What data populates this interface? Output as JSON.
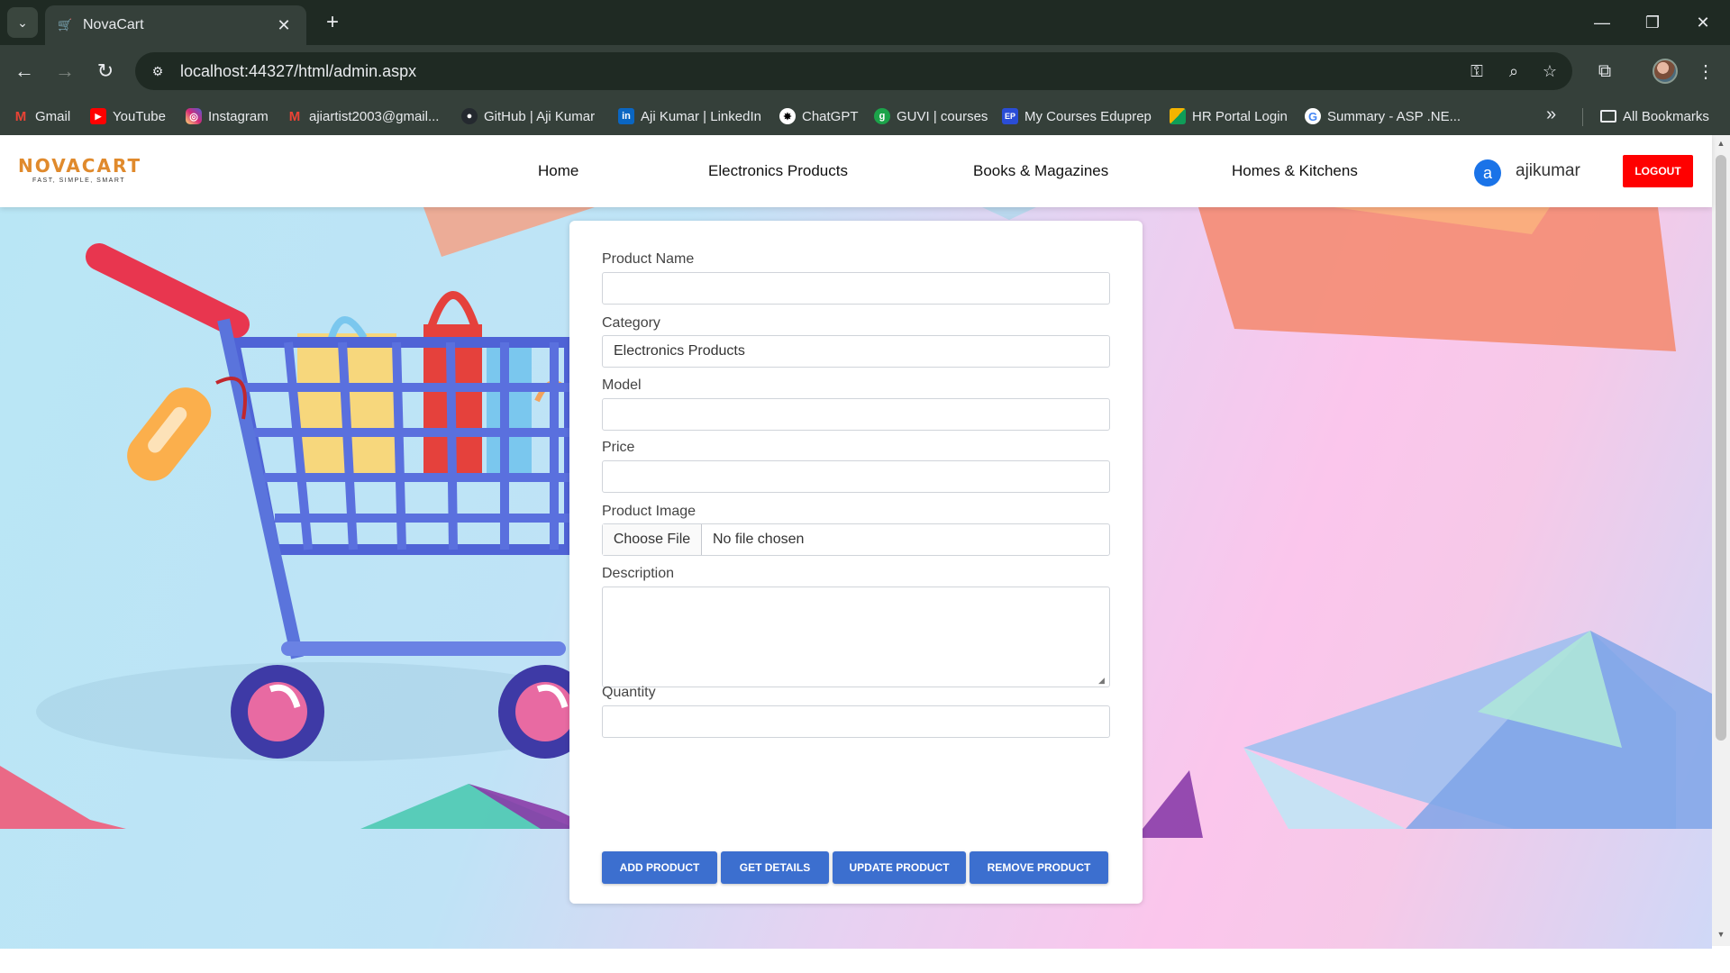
{
  "browser": {
    "tab_title": "NovaCart",
    "url": "localhost:44327/html/admin.aspx",
    "bookmarks": [
      {
        "label": "Gmail",
        "icon": "gmail-icon",
        "color": "#ea4335"
      },
      {
        "label": "YouTube",
        "icon": "youtube-icon",
        "color": "#ff0000"
      },
      {
        "label": "Instagram",
        "icon": "instagram-icon",
        "color": "#d62976"
      },
      {
        "label": "ajiartist2003@gmail...",
        "icon": "gmail-icon",
        "color": "#ea4335"
      },
      {
        "label": "GitHub | Aji Kumar",
        "icon": "github-icon",
        "color": "#24292f"
      },
      {
        "label": "Aji Kumar | LinkedIn",
        "icon": "linkedin-icon",
        "color": "#0a66c2"
      },
      {
        "label": "ChatGPT",
        "icon": "chatgpt-icon",
        "color": "#ffffff"
      },
      {
        "label": "GUVI | courses",
        "icon": "guvi-icon",
        "color": "#1ca34a"
      },
      {
        "label": "My Courses Eduprep",
        "icon": "eduprep-icon",
        "color": "#2a4dd6"
      },
      {
        "label": "HR Portal Login",
        "icon": "hr-portal-icon",
        "color": "#f4b400"
      },
      {
        "label": "Summary - ASP .NE...",
        "icon": "google-icon",
        "color": "#ffffff"
      }
    ],
    "all_bookmarks_label": "All Bookmarks"
  },
  "site": {
    "logo": "NOVACART",
    "tagline": "FAST, SIMPLE, SMART",
    "nav": [
      "Home",
      "Electronics Products",
      "Books & Magazines",
      "Homes & Kitchens"
    ],
    "user_initial": "a",
    "username": "ajikumar",
    "logout_label": "LOGOUT"
  },
  "form": {
    "product_name_label": "Product Name",
    "product_name_value": "",
    "category_label": "Category",
    "category_value": "Electronics Products",
    "model_label": "Model",
    "model_value": "",
    "price_label": "Price",
    "price_value": "",
    "image_label": "Product Image",
    "choose_file_label": "Choose File",
    "file_status": "No file chosen",
    "description_label": "Description",
    "description_value": "",
    "quantity_label": "Quantity",
    "quantity_value": "",
    "buttons": [
      "ADD PRODUCT",
      "GET DETAILS",
      "UPDATE PRODUCT",
      "REMOVE PRODUCT"
    ]
  },
  "colors": {
    "accent": "#3c6fcf",
    "logout": "#ff0000",
    "avatar": "#1a73e8",
    "logo": "#e08a2c"
  }
}
